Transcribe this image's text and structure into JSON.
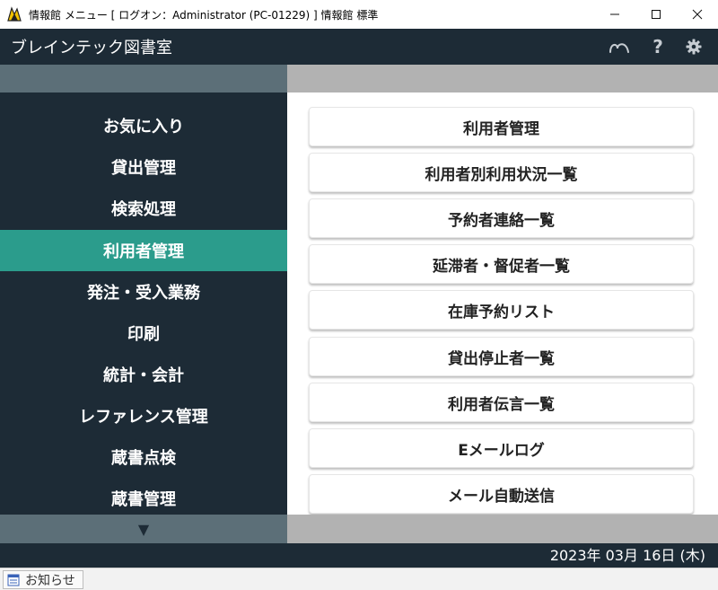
{
  "window": {
    "title": "情報館 メニュー [ ログオン：Administrator (PC-01229) ] 情報館 標準",
    "icon": "app-logo-icon",
    "controls": [
      "minimize-icon",
      "maximize-icon",
      "close-icon"
    ]
  },
  "header": {
    "title": "ブレインテック図書室",
    "icons": [
      "link-icon",
      "help-icon",
      "gear-icon"
    ],
    "help_glyph": "?"
  },
  "sidebar": {
    "items": [
      {
        "label": "お気に入り",
        "active": false
      },
      {
        "label": "貸出管理",
        "active": false
      },
      {
        "label": "検索処理",
        "active": false
      },
      {
        "label": "利用者管理",
        "active": true
      },
      {
        "label": "発注・受入業務",
        "active": false
      },
      {
        "label": "印刷",
        "active": false
      },
      {
        "label": "統計・会計",
        "active": false
      },
      {
        "label": "レファレンス管理",
        "active": false
      },
      {
        "label": "蔵書点検",
        "active": false
      },
      {
        "label": "蔵書管理",
        "active": false
      }
    ],
    "scroll_down_glyph": "▼"
  },
  "main": {
    "buttons": [
      "利用者管理",
      "利用者別利用状況一覧",
      "予約者連絡一覧",
      "延滞者・督促者一覧",
      "在庫予約リスト",
      "貸出停止者一覧",
      "利用者伝言一覧",
      "Eメールログ",
      "メール自動送信"
    ]
  },
  "status": {
    "date": "2023年 03月 16日 (木)"
  },
  "notice": {
    "label": "お知らせ"
  },
  "colors": {
    "dark_navy": "#1d2b36",
    "slate": "#5c6f78",
    "accent_teal": "#2b9c8c",
    "gray_strip": "#b2b2b2"
  }
}
